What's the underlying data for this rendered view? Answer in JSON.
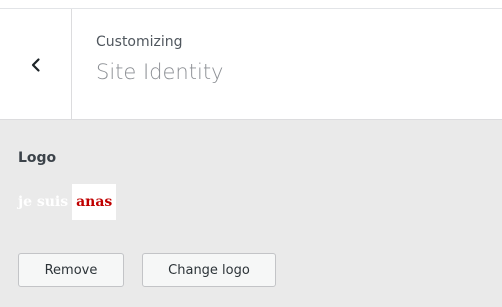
{
  "header": {
    "eyebrow": "Customizing",
    "title": "Site Identity",
    "back_icon": "chevron-left-icon"
  },
  "logo_control": {
    "label": "Logo",
    "logo_text_part1": "je suis",
    "logo_text_part2": "anas",
    "logo_color_part1": "#ffffff",
    "logo_color_part2": "#c00000"
  },
  "buttons": {
    "remove_label": "Remove",
    "change_label": "Change logo"
  }
}
